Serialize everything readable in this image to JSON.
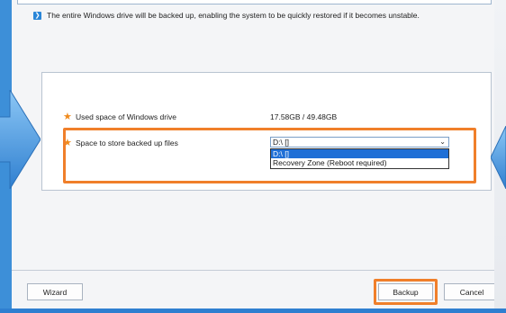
{
  "info": {
    "text": "The entire Windows drive will be backed up, enabling the system to be quickly restored if it becomes unstable."
  },
  "fields": {
    "used_space_label": "Used space of Windows drive",
    "used_space_value": "17.58GB / 49.48GB",
    "store_label": "Space to store backed up files",
    "store_selected": "D:\\ []"
  },
  "dropdown": {
    "options": [
      "D:\\ []",
      "Recovery Zone (Reboot required)"
    ],
    "selected_index": 0
  },
  "buttons": {
    "wizard": "Wizard",
    "backup": "Backup",
    "cancel": "Cancel"
  },
  "icons": {
    "info": "chevron-right-icon",
    "required": "asterisk-icon",
    "dropdown": "chevron-down-icon",
    "left_arrow": "arrow-right-icon",
    "right_arrow": "arrow-left-icon"
  },
  "colors": {
    "accent": "#2a86d8",
    "highlight": "#f07f2a",
    "required": "#f08a1c",
    "selection": "#1f6fd6"
  }
}
